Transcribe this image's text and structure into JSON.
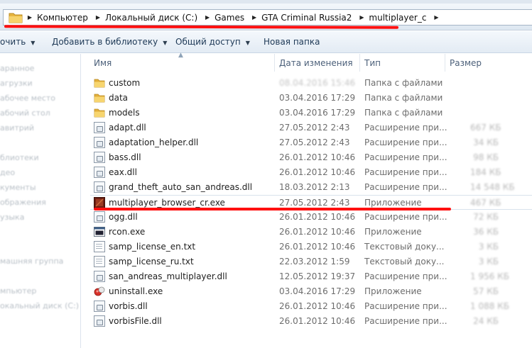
{
  "address_bar": {
    "crumbs": [
      "Компьютер",
      "Локальный диск (C:)",
      "Games",
      "GTA Criminal Russia2",
      "multiplayer_c"
    ]
  },
  "toolbar": {
    "organize_label": "очить",
    "add_to_library_label": "Добавить в библиотеку",
    "share_label": "Общий доступ",
    "new_folder_label": "Новая папка"
  },
  "navigation_pane": {
    "items": [
      "аранное",
      "агрузки",
      "абочее место",
      "абочий стол",
      "авитрий",
      "блиотеки",
      "део",
      "кументы",
      "ображения",
      "узыка",
      "машняя группа",
      "мпьютер",
      "окальный диск (C:)"
    ]
  },
  "columns": {
    "name": "Имя",
    "date": "Дата изменения",
    "type": "Тип",
    "size": "Размер"
  },
  "files": [
    {
      "name": "custom",
      "date": "08.04.2016 15:46",
      "type": "Папка с файлами",
      "size": "",
      "icon": "folder-icon"
    },
    {
      "name": "data",
      "date": "03.04.2016 17:29",
      "type": "Папка с файлами",
      "size": "",
      "icon": "folder-icon"
    },
    {
      "name": "models",
      "date": "03.04.2016 17:29",
      "type": "Папка с файлами",
      "size": "",
      "icon": "folder-icon"
    },
    {
      "name": "adapt.dll",
      "date": "27.05.2012 2:43",
      "type": "Расширение при...",
      "size": "667 КБ",
      "icon": "dll-icon"
    },
    {
      "name": "adaptation_helper.dll",
      "date": "27.05.2012 2:43",
      "type": "Расширение при...",
      "size": "34 КБ",
      "icon": "dll-icon"
    },
    {
      "name": "bass.dll",
      "date": "26.01.2012 10:46",
      "type": "Расширение при...",
      "size": "98 КБ",
      "icon": "dll-icon"
    },
    {
      "name": "eax.dll",
      "date": "26.01.2012 10:46",
      "type": "Расширение при...",
      "size": "184 КБ",
      "icon": "dll-icon"
    },
    {
      "name": "grand_theft_auto_san_andreas.dll",
      "date": "18.03.2012 2:13",
      "type": "Расширение при...",
      "size": "14 548 КБ",
      "icon": "dll-icon"
    },
    {
      "name": "multiplayer_browser_cr.exe",
      "date": "27.05.2012 2:43",
      "type": "Приложение",
      "size": "467 КБ",
      "icon": "app-icon"
    },
    {
      "name": "ogg.dll",
      "date": "26.01.2012 10:46",
      "type": "Расширение при...",
      "size": "72 КБ",
      "icon": "dll-icon"
    },
    {
      "name": "rcon.exe",
      "date": "26.01.2012 10:46",
      "type": "Приложение",
      "size": "36 КБ",
      "icon": "console-icon"
    },
    {
      "name": "samp_license_en.txt",
      "date": "26.01.2012 10:46",
      "type": "Текстовый доку...",
      "size": "3 КБ",
      "icon": "text-file-icon"
    },
    {
      "name": "samp_license_ru.txt",
      "date": "22.03.2012 1:59",
      "type": "Текстовый доку...",
      "size": "3 КБ",
      "icon": "text-file-icon"
    },
    {
      "name": "san_andreas_multiplayer.dll",
      "date": "12.05.2012 19:37",
      "type": "Расширение при...",
      "size": "1 956 КБ",
      "icon": "dll-icon"
    },
    {
      "name": "uninstall.exe",
      "date": "03.04.2016 17:29",
      "type": "Приложение",
      "size": "57 КБ",
      "icon": "uninstall-icon"
    },
    {
      "name": "vorbis.dll",
      "date": "26.01.2012 10:46",
      "type": "Расширение при...",
      "size": "1 088 КБ",
      "icon": "dll-icon"
    },
    {
      "name": "vorbisFile.dll",
      "date": "26.01.2012 10:46",
      "type": "Расширение при...",
      "size": "24 КБ",
      "icon": "dll-icon"
    }
  ],
  "colors": {
    "annotation_red": "#ff1010",
    "toolbar_text": "#1e3956",
    "header_text": "#4c607a",
    "folder_yellow": "#f1c75a"
  }
}
